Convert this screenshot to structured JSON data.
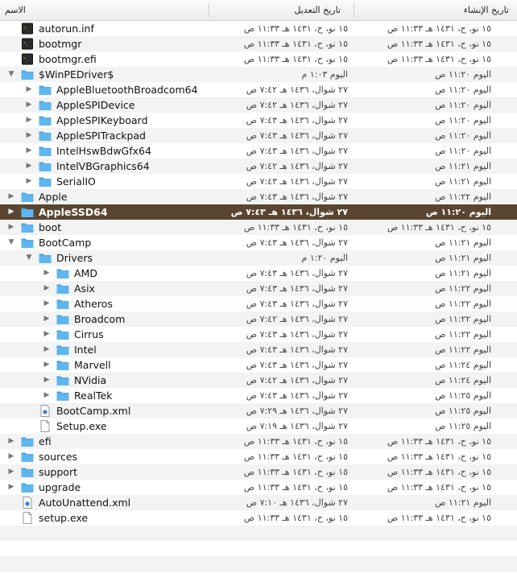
{
  "header": {
    "name": "الاسم",
    "modified": "تاريخ التعديل",
    "created": "تاريخ الإنشاء"
  },
  "rows": [
    {
      "name": "autorun.inf",
      "depth": 0,
      "type": "file-dark",
      "expanded": null,
      "modified": "١٥ نو، ح، ١٤٣١ هـ ١١:٣٣ ص",
      "created": "١٥ نو، ح، ١٤٣١ هـ ١١:٣٣ ص"
    },
    {
      "name": "bootmgr",
      "depth": 0,
      "type": "file-dark",
      "expanded": null,
      "modified": "١٥ نو، ح، ١٤٣١ هـ ١١:٣٣ ص",
      "created": "١٥ نو، ح، ١٤٣١ هـ ١١:٣٣ ص"
    },
    {
      "name": "bootmgr.efi",
      "depth": 0,
      "type": "file-dark",
      "expanded": null,
      "modified": "١٥ نو، ح، ١٤٣١ هـ ١١:٣٣ ص",
      "created": "١٥ نو، ح، ١٤٣١ هـ ١١:٣٣ ص"
    },
    {
      "name": "$WinPEDriver$",
      "depth": 0,
      "type": "folder",
      "expanded": true,
      "modified": "اليوم ١:٠٣ م",
      "created": "اليوم ١١:٢٠ ص"
    },
    {
      "name": "AppleBluetoothBroadcom64",
      "depth": 1,
      "type": "folder",
      "expanded": false,
      "modified": "٢٧ شوال، ١٤٣٦ هـ ٧:٤٢ ص",
      "created": "اليوم ١١:٢٠ ص"
    },
    {
      "name": "AppleSPIDevice",
      "depth": 1,
      "type": "folder",
      "expanded": false,
      "modified": "٢٧ شوال، ١٤٣٦ هـ ٧:٤٢ ص",
      "created": "اليوم ١١:٢٠ ص"
    },
    {
      "name": "AppleSPIKeyboard",
      "depth": 1,
      "type": "folder",
      "expanded": false,
      "modified": "٢٧ شوال، ١٤٣٦ هـ ٧:٤٣ ص",
      "created": "اليوم ١١:٢٠ ص"
    },
    {
      "name": "AppleSPITrackpad",
      "depth": 1,
      "type": "folder",
      "expanded": false,
      "modified": "٢٧ شوال، ١٤٣٦ هـ ٧:٤٣ ص",
      "created": "اليوم ١١:٢٠ ص"
    },
    {
      "name": "IntelHswBdwGfx64",
      "depth": 1,
      "type": "folder",
      "expanded": false,
      "modified": "٢٧ شوال، ١٤٣٦ هـ ٧:٤٣ ص",
      "created": "اليوم ١١:٢٠ ص"
    },
    {
      "name": "IntelVBGraphics64",
      "depth": 1,
      "type": "folder",
      "expanded": false,
      "modified": "٢٧ شوال، ١٤٣٦ هـ ٧:٤٢ ص",
      "created": "اليوم ١١:٢١ ص"
    },
    {
      "name": "SerialIO",
      "depth": 1,
      "type": "folder",
      "expanded": false,
      "modified": "٢٧ شوال، ١٤٣٦ هـ ٧:٤٣ ص",
      "created": "اليوم ١١:٢١ ص"
    },
    {
      "name": "Apple",
      "depth": 0,
      "type": "folder",
      "expanded": false,
      "modified": "٢٧ شوال، ١٤٣٦ هـ ٧:٤٣ ص",
      "created": "اليوم ١١:٢٢ ص"
    },
    {
      "name": "AppleSSD64",
      "depth": 0,
      "type": "folder",
      "expanded": false,
      "selected": true,
      "modified": "٢٧ شوال، ١٤٣٦ هـ ٧:٤٣ ص",
      "created": "اليوم ١١:٢٠ ص"
    },
    {
      "name": "boot",
      "depth": 0,
      "type": "folder",
      "expanded": false,
      "modified": "١٥ نو، ح، ١٤٣١ هـ ١١:٣٣ ص",
      "created": "١٥ نو، ح، ١٤٣١ هـ ١١:٣٣ ص"
    },
    {
      "name": "BootCamp",
      "depth": 0,
      "type": "folder",
      "expanded": true,
      "modified": "٢٧ شوال، ١٤٣٦ هـ ٧:٤٣ ص",
      "created": "اليوم ١١:٢١ ص"
    },
    {
      "name": "Drivers",
      "depth": 1,
      "type": "folder",
      "expanded": true,
      "modified": "اليوم ١:٢٠ م",
      "created": "اليوم ١١:٢١ ص"
    },
    {
      "name": "AMD",
      "depth": 2,
      "type": "folder",
      "expanded": false,
      "modified": "٢٧ شوال، ١٤٣٦ هـ ٧:٤٣ ص",
      "created": "اليوم ١١:٢١ ص"
    },
    {
      "name": "Asix",
      "depth": 2,
      "type": "folder",
      "expanded": false,
      "modified": "٢٧ شوال، ١٤٣٦ هـ ٧:٤٣ ص",
      "created": "اليوم ١١:٢٢ ص"
    },
    {
      "name": "Atheros",
      "depth": 2,
      "type": "folder",
      "expanded": false,
      "modified": "٢٧ شوال، ١٤٣٦ هـ ٧:٤٣ ص",
      "created": "اليوم ١١:٢٢ ص"
    },
    {
      "name": "Broadcom",
      "depth": 2,
      "type": "folder",
      "expanded": false,
      "modified": "٢٧ شوال، ١٤٣٦ هـ ٧:٤٢ ص",
      "created": "اليوم ١١:٢٢ ص"
    },
    {
      "name": "Cirrus",
      "depth": 2,
      "type": "folder",
      "expanded": false,
      "modified": "٢٧ شوال، ١٤٣٦ هـ ٧:٤٣ ص",
      "created": "اليوم ١١:٢٢ ص"
    },
    {
      "name": "Intel",
      "depth": 2,
      "type": "folder",
      "expanded": false,
      "modified": "٢٧ شوال، ١٤٣٦ هـ ٧:٤٣ ص",
      "created": "اليوم ١١:٢٢ ص"
    },
    {
      "name": "Marvell",
      "depth": 2,
      "type": "folder",
      "expanded": false,
      "modified": "٢٧ شوال، ١٤٣٦ هـ ٧:٤٣ ص",
      "created": "اليوم ١١:٢٤ ص"
    },
    {
      "name": "NVidia",
      "depth": 2,
      "type": "folder",
      "expanded": false,
      "modified": "٢٧ شوال، ١٤٣٦ هـ ٧:٤٢ ص",
      "created": "اليوم ١١:٢٤ ص"
    },
    {
      "name": "RealTek",
      "depth": 2,
      "type": "folder",
      "expanded": false,
      "modified": "٢٧ شوال، ١٤٣٦ هـ ٧:٤٣ ص",
      "created": "اليوم ١١:٢٥ ص"
    },
    {
      "name": "BootCamp.xml",
      "depth": 1,
      "type": "file-xml",
      "expanded": null,
      "modified": "٢٧ شوال، ١٤٣٦ هـ ٧:٢٩ ص",
      "created": "اليوم ١١:٢٥ ص"
    },
    {
      "name": "Setup.exe",
      "depth": 1,
      "type": "file",
      "expanded": null,
      "modified": "٢٧ شوال، ١٤٣٦ هـ ٧:١٩ ص",
      "created": "اليوم ١١:٢٥ ص"
    },
    {
      "name": "efi",
      "depth": 0,
      "type": "folder",
      "expanded": false,
      "modified": "١٥ نو، ح، ١٤٣١ هـ ١١:٣٣ ص",
      "created": "١٥ نو، ح، ١٤٣١ هـ ١١:٣٣ ص"
    },
    {
      "name": "sources",
      "depth": 0,
      "type": "folder",
      "expanded": false,
      "modified": "١٥ نو، ح، ١٤٣١ هـ ١١:٣٣ ص",
      "created": "١٥ نو، ح، ١٤٣١ هـ ١١:٣٣ ص"
    },
    {
      "name": "support",
      "depth": 0,
      "type": "folder",
      "expanded": false,
      "modified": "١٥ نو، ح، ١٤٣١ هـ ١١:٣٣ ص",
      "created": "١٥ نو، ح، ١٤٣١ هـ ١١:٣٣ ص"
    },
    {
      "name": "upgrade",
      "depth": 0,
      "type": "folder",
      "expanded": false,
      "modified": "١٥ نو، ح، ١٤٣١ هـ ١١:٣٣ ص",
      "created": "١٥ نو، ح، ١٤٣١ هـ ١١:٣٣ ص"
    },
    {
      "name": "AutoUnattend.xml",
      "depth": 0,
      "type": "file-xml",
      "expanded": null,
      "modified": "٢٧ شوال، ١٤٣٦ هـ ٧:١٠ ص",
      "created": "اليوم ١١:٢١ ص"
    },
    {
      "name": "setup.exe",
      "depth": 0,
      "type": "file",
      "expanded": null,
      "modified": "١٥ نو، ح، ١٤٣١ هـ ١١:٣٣ ص",
      "created": "١٥ نو، ح، ١٤٣١ هـ ١١:٣٣ ص"
    }
  ],
  "colors": {
    "folder": "#5fb6ef",
    "folder_tab": "#4aa2e0",
    "selected": "#5a4630",
    "stripe": "#f3f3f3"
  }
}
